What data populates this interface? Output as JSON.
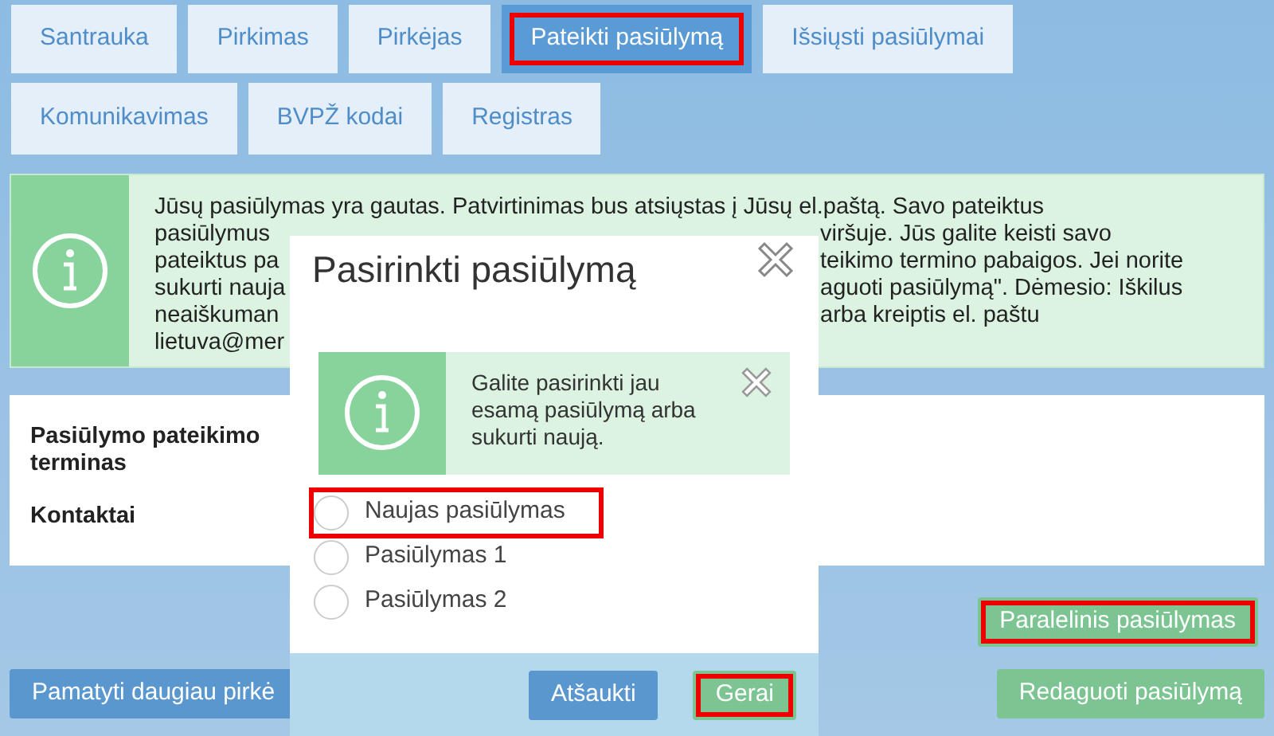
{
  "tabs": [
    {
      "label": "Santrauka",
      "selected": false,
      "highlighted": false
    },
    {
      "label": "Pirkimas",
      "selected": false,
      "highlighted": false
    },
    {
      "label": "Pirkėjas",
      "selected": false,
      "highlighted": false
    },
    {
      "label": "Pateikti pasiūlymą",
      "selected": true,
      "highlighted": true
    },
    {
      "label": "Išsiųsti pasiūlymai",
      "selected": false,
      "highlighted": false
    },
    {
      "label": "Komunikavimas",
      "selected": false,
      "highlighted": false
    },
    {
      "label": "BVPŽ kodai",
      "selected": false,
      "highlighted": false
    },
    {
      "label": "Registras",
      "selected": false,
      "highlighted": false
    }
  ],
  "info_message": {
    "lines": [
      {
        "left": "Jūsų pasiūlymas yra gautas. Patvirtinimas bus atsiųstas į Jūsų el.paštą. Savo pateiktus"
      },
      {
        "left": "pasiūlymus",
        "right": "viršuje. Jūs galite keisti savo"
      },
      {
        "left": "pateiktus pa",
        "right": "teikimo termino pabaigos. Jei norite"
      },
      {
        "left": "sukurti nauja",
        "right": "aguoti pasiūlymą\". Dėmesio: Iškilus"
      },
      {
        "left": "neaiškuman",
        "right": "arba kreiptis el. paštu"
      },
      {
        "left": "lietuva@mer"
      }
    ]
  },
  "details": [
    {
      "label": "Pasiūlymo pateikimo terminas"
    },
    {
      "label": "Kontaktai"
    }
  ],
  "buttons": [
    {
      "label": "Paralelinis pasiūlymas",
      "kind": "green",
      "highlighted": true
    },
    {
      "label": "Pamatyti daugiau pirkė",
      "kind": "blue",
      "highlighted": false
    },
    {
      "label": "Redaguoti pasiūlymą",
      "kind": "green",
      "highlighted": false
    }
  ],
  "dialog": {
    "title": "Pasirinkti pasiūlymą",
    "info": "Galite pasirinkti jau esamą pasiūlymą arba sukurti naują.",
    "options": [
      {
        "label": "Naujas pasiūlymas",
        "selected": false,
        "highlighted": true
      },
      {
        "label": "Pasiūlymas 1",
        "selected": false,
        "highlighted": false
      },
      {
        "label": "Pasiūlymas 2",
        "selected": false,
        "highlighted": false
      }
    ],
    "buttons": [
      {
        "label": "Atšaukti",
        "kind": "blue",
        "highlighted": false
      },
      {
        "label": "Gerai",
        "kind": "green",
        "highlighted": true
      }
    ]
  }
}
